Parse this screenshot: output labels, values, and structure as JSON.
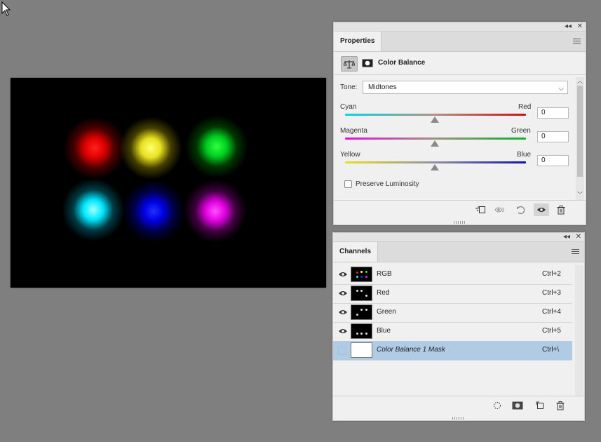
{
  "canvas": {
    "glows": [
      {
        "color": "#ff1010"
      },
      {
        "color": "#f5f020"
      },
      {
        "color": "#10e020"
      },
      {
        "color": "#10f0ff"
      },
      {
        "color": "#1010ff"
      },
      {
        "color": "#f010f0"
      }
    ]
  },
  "properties": {
    "tab_label": "Properties",
    "adjustment_title": "Color Balance",
    "tone_label": "Tone:",
    "tone_value": "Midtones",
    "sliders": [
      {
        "left": "Cyan",
        "right": "Red",
        "value": "0"
      },
      {
        "left": "Magenta",
        "right": "Green",
        "value": "0"
      },
      {
        "left": "Yellow",
        "right": "Blue",
        "value": "0"
      }
    ],
    "preserve_luminosity_label": "Preserve Luminosity",
    "preserve_luminosity_checked": false
  },
  "channels": {
    "tab_label": "Channels",
    "rows": [
      {
        "name": "RGB",
        "shortcut": "Ctrl+2"
      },
      {
        "name": "Red",
        "shortcut": "Ctrl+3"
      },
      {
        "name": "Green",
        "shortcut": "Ctrl+4"
      },
      {
        "name": "Blue",
        "shortcut": "Ctrl+5"
      },
      {
        "name": "Color Balance 1 Mask",
        "shortcut": "Ctrl+\\"
      }
    ]
  },
  "colors": {
    "panel_bg": "#f0f0f0",
    "selected_row": "#b0cbe4",
    "app_bg": "#7f7f7f"
  }
}
